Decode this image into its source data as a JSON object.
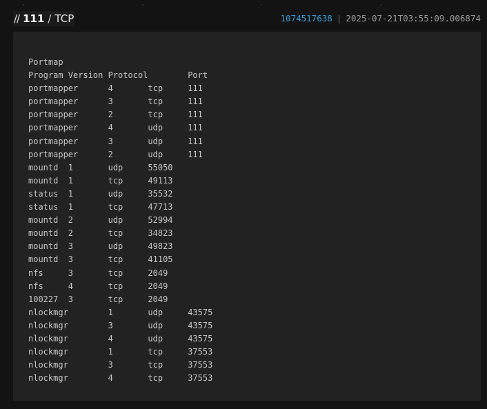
{
  "header": {
    "slashes": "//",
    "port": "111",
    "separator": "/",
    "protocol": "TCP",
    "ip_number": "1074517638",
    "pipe": "|",
    "timestamp": "2025-07-21T03:55:09.006874"
  },
  "banner": {
    "lines": [
      "Portmap",
      "Program Version Protocol        Port",
      "portmapper      4       tcp     111",
      "portmapper      3       tcp     111",
      "portmapper      2       tcp     111",
      "portmapper      4       udp     111",
      "portmapper      3       udp     111",
      "portmapper      2       udp     111",
      "mountd  1       udp     55050",
      "mountd  1       tcp     49113",
      "status  1       udp     35532",
      "status  1       tcp     47713",
      "mountd  2       udp     52994",
      "mountd  2       tcp     34823",
      "mountd  3       udp     49823",
      "mountd  3       tcp     41105",
      "nfs     3       tcp     2049",
      "nfs     4       tcp     2049",
      "100227  3       tcp     2049",
      "nlockmgr        1       udp     43575",
      "nlockmgr        3       udp     43575",
      "nlockmgr        4       udp     43575",
      "nlockmgr        1       tcp     37553",
      "nlockmgr        3       tcp     37553",
      "nlockmgr        4       tcp     37553"
    ]
  }
}
